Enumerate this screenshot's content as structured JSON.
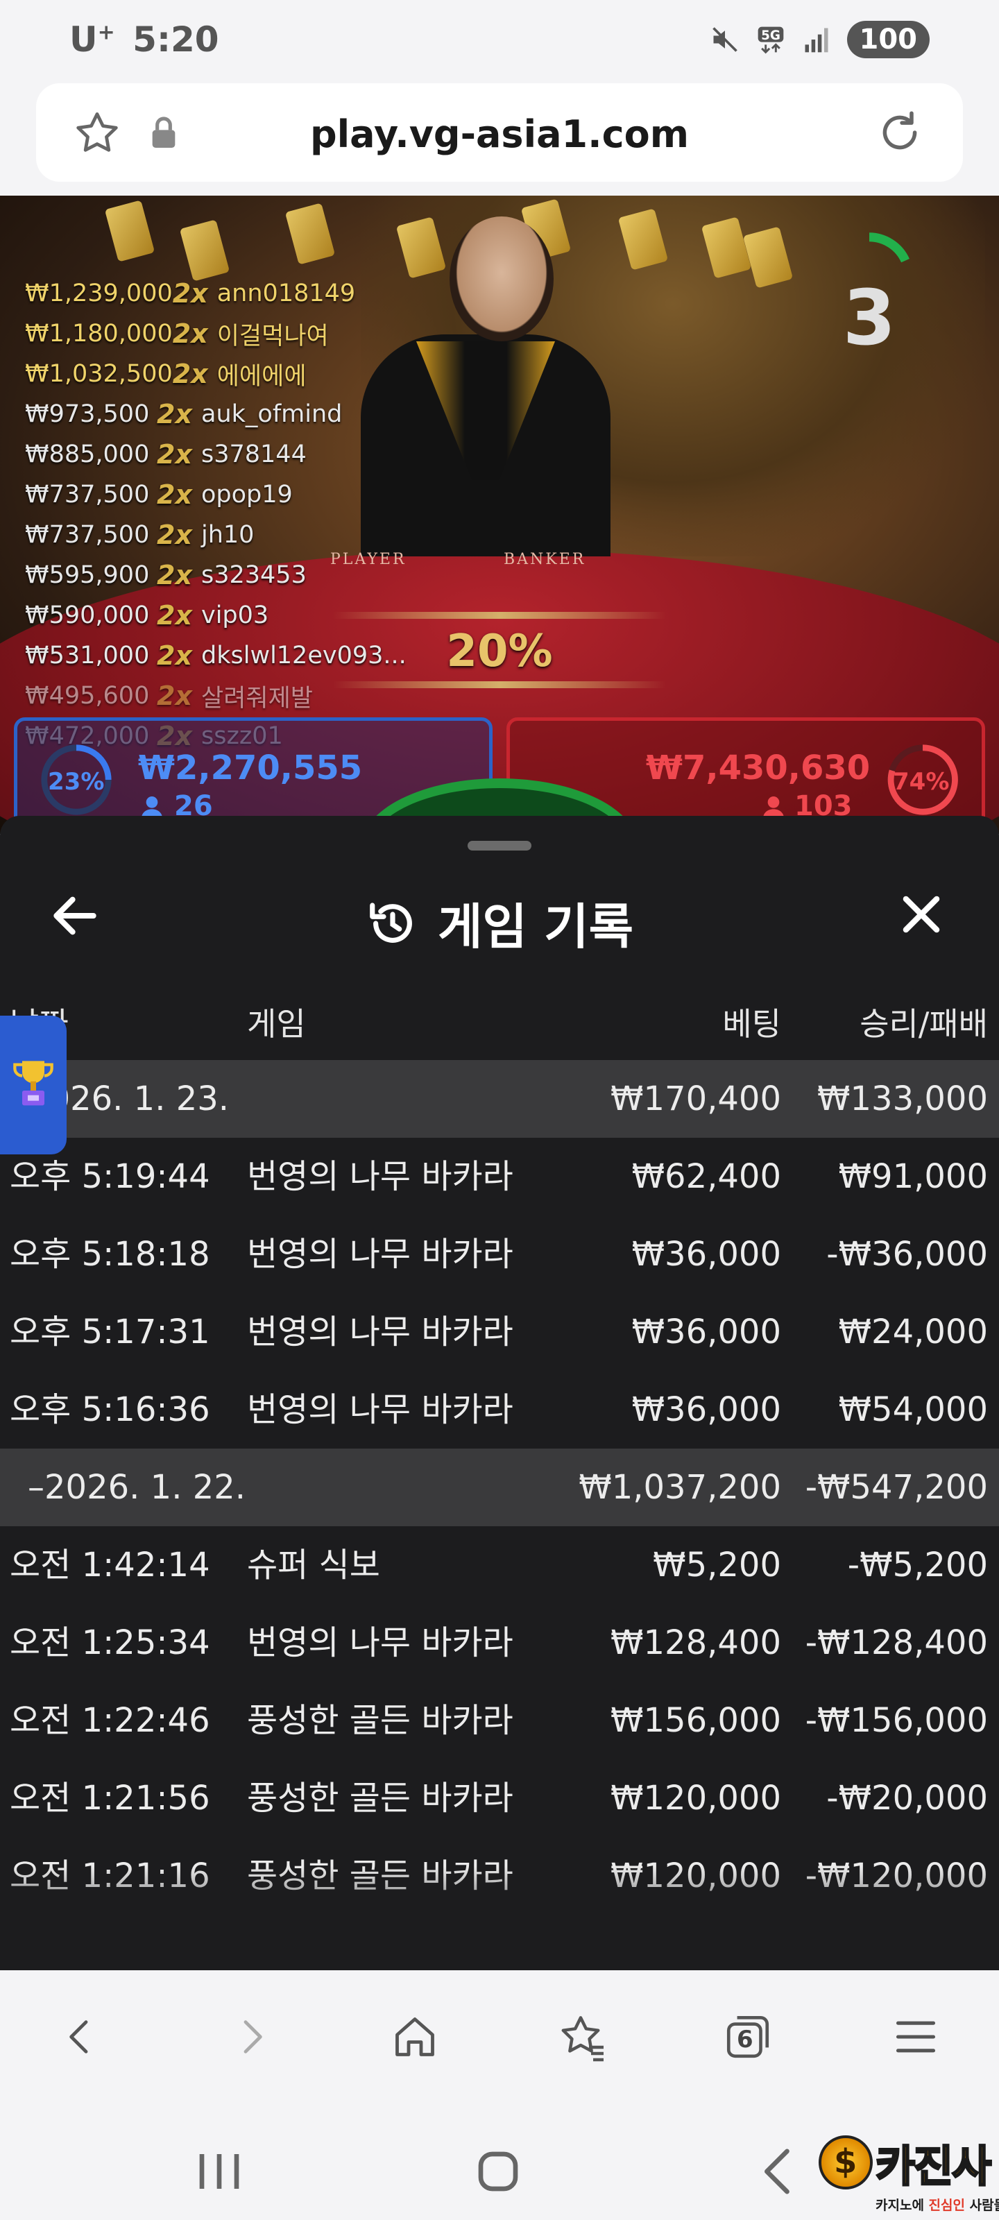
{
  "status_bar": {
    "carrier": "U",
    "carrier_sup": "+",
    "time": "5:20",
    "network": "5G",
    "battery": "100"
  },
  "browser": {
    "url": "play.vg-asia1.com"
  },
  "video": {
    "winners": [
      {
        "amount": "₩1,239,000",
        "mult": "2x",
        "user": "ann018149",
        "top": true
      },
      {
        "amount": "₩1,180,000",
        "mult": "2x",
        "user": "이걸먹나여",
        "top": true
      },
      {
        "amount": "₩1,032,500",
        "mult": "2x",
        "user": "에에에에",
        "top": true
      },
      {
        "amount": "₩973,500",
        "mult": "2x",
        "user": "auk_ofmind",
        "top": false
      },
      {
        "amount": "₩885,000",
        "mult": "2x",
        "user": "s378144",
        "top": false
      },
      {
        "amount": "₩737,500",
        "mult": "2x",
        "user": "opop19",
        "top": false
      },
      {
        "amount": "₩737,500",
        "mult": "2x",
        "user": "jh10",
        "top": false
      },
      {
        "amount": "₩595,900",
        "mult": "2x",
        "user": "s323453",
        "top": false
      },
      {
        "amount": "₩590,000",
        "mult": "2x",
        "user": "vip03",
        "top": false
      },
      {
        "amount": "₩531,000",
        "mult": "2x",
        "user": "dkslwl12ev093...",
        "top": false
      },
      {
        "amount": "₩495,600",
        "mult": "2x",
        "user": "살려줘제발",
        "top": false
      },
      {
        "amount": "₩472,000",
        "mult": "2x",
        "user": "sszz01",
        "top": false
      }
    ],
    "countdown": "3",
    "table_player": "PLAYER",
    "table_banker": "BANKER",
    "center_percent": "20%",
    "player": {
      "percent": "23%",
      "total": "₩2,270,555",
      "count": "26"
    },
    "banker": {
      "percent": "74%",
      "total": "₩7,430,630",
      "count": "103"
    }
  },
  "sheet": {
    "title": "게임 기록",
    "columns": {
      "date": "날짜",
      "game": "게임",
      "bet": "베팅",
      "win_loss": "승리/패배"
    },
    "groups": [
      {
        "date": "2026. 1. 23.",
        "bet": "₩170,400",
        "win_loss": "₩133,000",
        "rows": [
          {
            "time": "오후 5:19:44",
            "game": "번영의 나무 바카라",
            "bet": "₩62,400",
            "win_loss": "₩91,000"
          },
          {
            "time": "오후 5:18:18",
            "game": "번영의 나무 바카라",
            "bet": "₩36,000",
            "win_loss": "-₩36,000"
          },
          {
            "time": "오후 5:17:31",
            "game": "번영의 나무 바카라",
            "bet": "₩36,000",
            "win_loss": "₩24,000"
          },
          {
            "time": "오후 5:16:36",
            "game": "번영의 나무 바카라",
            "bet": "₩36,000",
            "win_loss": "₩54,000"
          }
        ]
      },
      {
        "date": "–2026. 1. 22.",
        "bet": "₩1,037,200",
        "win_loss": "-₩547,200",
        "rows": [
          {
            "time": "오전 1:42:14",
            "game": "슈퍼 식보",
            "bet": "₩5,200",
            "win_loss": "-₩5,200"
          },
          {
            "time": "오전 1:25:34",
            "game": "번영의 나무 바카라",
            "bet": "₩128,400",
            "win_loss": "-₩128,400"
          },
          {
            "time": "오전 1:22:46",
            "game": "풍성한 골든 바카라",
            "bet": "₩156,000",
            "win_loss": "-₩156,000"
          },
          {
            "time": "오전 1:21:56",
            "game": "풍성한 골든 바카라",
            "bet": "₩120,000",
            "win_loss": "-₩20,000"
          },
          {
            "time": "오전 1:21:16",
            "game": "풍성한 골든 바카라",
            "bet": "₩120,000",
            "win_loss": "-₩120,000"
          }
        ]
      }
    ]
  },
  "nav": {
    "tabs_count": "6"
  },
  "watermark": {
    "title": "카진사",
    "sub_a": "카지노에 ",
    "sub_b": "진심인",
    "sub_c": " 사람들"
  },
  "colors": {
    "accent_blue": "#2b5cd0",
    "sheet_bg": "#1c1c1e",
    "group_bg": "#3a3a3c",
    "player_blue": "#2c63c8",
    "banker_red": "#c8262f",
    "gold": "#e8c36a"
  }
}
